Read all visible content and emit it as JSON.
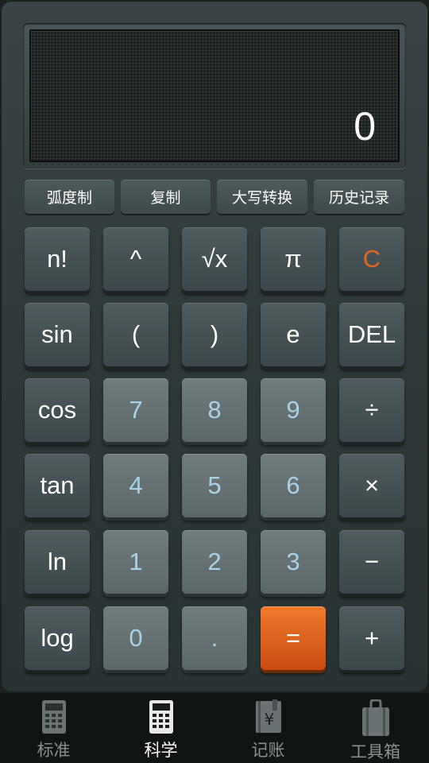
{
  "display": {
    "value": "0"
  },
  "function_bar": [
    "弧度制",
    "复制",
    "大写转换",
    "历史记录"
  ],
  "keys": [
    [
      {
        "label": "n!",
        "style": "dark"
      },
      {
        "label": "^",
        "style": "dark"
      },
      {
        "label": "√x",
        "style": "dark"
      },
      {
        "label": "π",
        "style": "dark"
      },
      {
        "label": "C",
        "style": "dark clear"
      }
    ],
    [
      {
        "label": "sin",
        "style": "dark"
      },
      {
        "label": "(",
        "style": "dark"
      },
      {
        "label": ")",
        "style": "dark"
      },
      {
        "label": "e",
        "style": "dark"
      },
      {
        "label": "DEL",
        "style": "dark"
      }
    ],
    [
      {
        "label": "cos",
        "style": "dark"
      },
      {
        "label": "7",
        "style": "light"
      },
      {
        "label": "8",
        "style": "light"
      },
      {
        "label": "9",
        "style": "light"
      },
      {
        "label": "÷",
        "style": "dark"
      }
    ],
    [
      {
        "label": "tan",
        "style": "dark"
      },
      {
        "label": "4",
        "style": "light"
      },
      {
        "label": "5",
        "style": "light"
      },
      {
        "label": "6",
        "style": "light"
      },
      {
        "label": "×",
        "style": "dark"
      }
    ],
    [
      {
        "label": "ln",
        "style": "dark"
      },
      {
        "label": "1",
        "style": "light"
      },
      {
        "label": "2",
        "style": "light"
      },
      {
        "label": "3",
        "style": "light"
      },
      {
        "label": "−",
        "style": "dark"
      }
    ],
    [
      {
        "label": "log",
        "style": "dark"
      },
      {
        "label": "0",
        "style": "light"
      },
      {
        "label": ".",
        "style": "light"
      },
      {
        "label": "=",
        "style": "orange"
      },
      {
        "label": "+",
        "style": "dark"
      }
    ]
  ],
  "tabs": [
    {
      "label": "标准",
      "icon": "calculator-icon",
      "active": false
    },
    {
      "label": "科学",
      "icon": "calculator-icon",
      "active": true
    },
    {
      "label": "记账",
      "icon": "ledger-icon",
      "active": false
    },
    {
      "label": "工具箱",
      "icon": "toolbox-icon",
      "active": false
    }
  ],
  "colors": {
    "accent_orange": "#e2661e",
    "digit_text": "#a8d2e8",
    "tab_active": "#ffffff",
    "tab_inactive": "#8a9092"
  }
}
